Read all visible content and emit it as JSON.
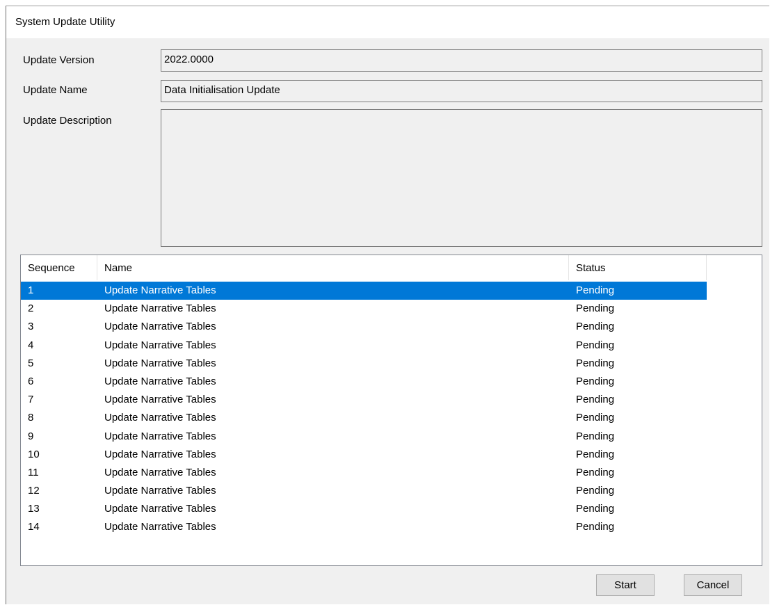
{
  "window": {
    "title": "System Update Utility"
  },
  "form": {
    "version_label": "Update Version",
    "version_value": "2022.0000",
    "name_label": "Update Name",
    "name_value": "Data Initialisation Update",
    "description_label": "Update Description",
    "description_value": ""
  },
  "table": {
    "columns": [
      "Sequence",
      "Name",
      "Status"
    ],
    "selected_index": 0,
    "rows": [
      {
        "sequence": "1",
        "name": "Update Narrative Tables",
        "status": "Pending"
      },
      {
        "sequence": "2",
        "name": "Update Narrative Tables",
        "status": "Pending"
      },
      {
        "sequence": "3",
        "name": "Update Narrative Tables",
        "status": "Pending"
      },
      {
        "sequence": "4",
        "name": "Update Narrative Tables",
        "status": "Pending"
      },
      {
        "sequence": "5",
        "name": "Update Narrative Tables",
        "status": "Pending"
      },
      {
        "sequence": "6",
        "name": "Update Narrative Tables",
        "status": "Pending"
      },
      {
        "sequence": "7",
        "name": "Update Narrative Tables",
        "status": "Pending"
      },
      {
        "sequence": "8",
        "name": "Update Narrative Tables",
        "status": "Pending"
      },
      {
        "sequence": "9",
        "name": "Update Narrative Tables",
        "status": "Pending"
      },
      {
        "sequence": "10",
        "name": "Update Narrative Tables",
        "status": "Pending"
      },
      {
        "sequence": "11",
        "name": "Update Narrative Tables",
        "status": "Pending"
      },
      {
        "sequence": "12",
        "name": "Update Narrative Tables",
        "status": "Pending"
      },
      {
        "sequence": "13",
        "name": "Update Narrative Tables",
        "status": "Pending"
      },
      {
        "sequence": "14",
        "name": "Update Narrative Tables",
        "status": "Pending"
      }
    ]
  },
  "buttons": {
    "start": "Start",
    "cancel": "Cancel"
  },
  "colors": {
    "selection": "#0078d7",
    "window_bg": "#f0f0f0"
  }
}
